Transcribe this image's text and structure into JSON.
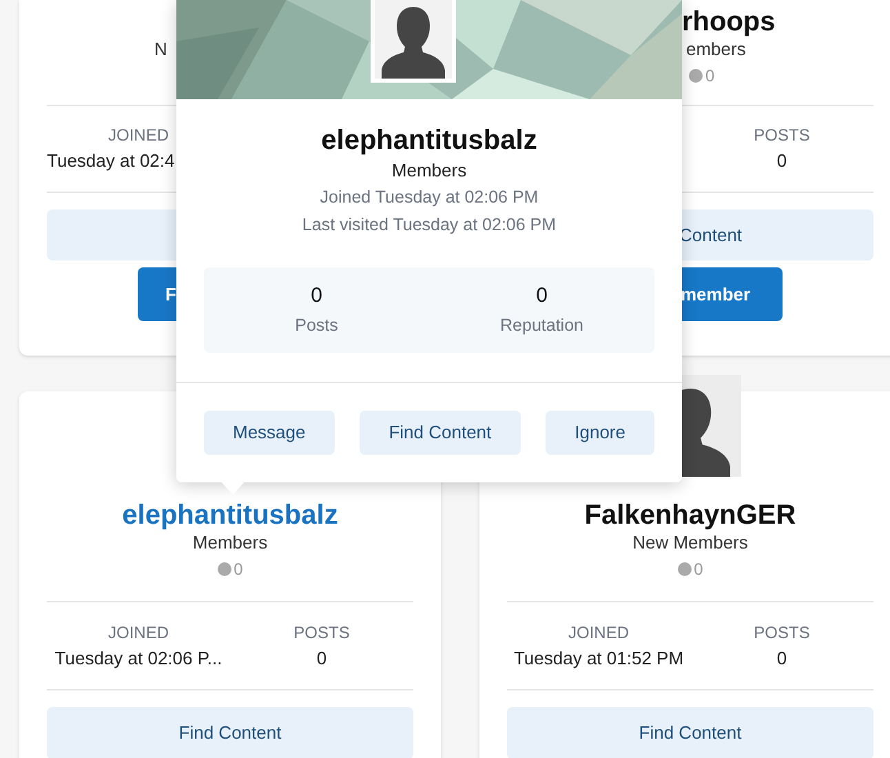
{
  "top_cards": [
    {
      "group": "N",
      "joined_label": "JOINED",
      "joined": "Tuesday at 02:4",
      "follow_button": "F"
    },
    {
      "name": "rhoops",
      "group": "embers",
      "reputation": "0",
      "posts_label": "POSTS",
      "posts": "0",
      "find_button": "Content",
      "follow_button": "member"
    }
  ],
  "member_cards": [
    {
      "name": "elephantitusbalz",
      "highlighted": true,
      "avatar_visible": false,
      "group": "Members",
      "reputation": "0",
      "joined_label": "JOINED",
      "joined": "Tuesday at 02:06 P...",
      "posts_label": "POSTS",
      "posts": "0",
      "button": "Find Content"
    },
    {
      "name": "FalkenhaynGER",
      "highlighted": false,
      "avatar_visible": true,
      "group": "New Members",
      "reputation": "0",
      "joined_label": "JOINED",
      "joined": "Tuesday at 01:52 PM",
      "posts_label": "POSTS",
      "posts": "0",
      "button": "Find Content"
    }
  ],
  "hover_card": {
    "name": "elephantitusbalz",
    "group": "Members",
    "joined": "Joined Tuesday at 02:06 PM",
    "last_visited": "Last visited Tuesday at 02:06 PM",
    "stats": [
      {
        "value": "0",
        "label": "Posts"
      },
      {
        "value": "0",
        "label": "Reputation"
      }
    ],
    "buttons": [
      "Message",
      "Find Content",
      "Ignore"
    ]
  }
}
